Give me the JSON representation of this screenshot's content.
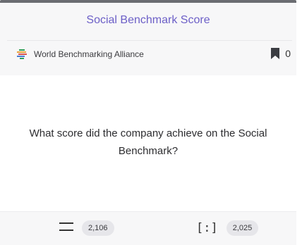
{
  "header": {
    "title": "Social Benchmark Score",
    "source": {
      "name": "World Benchmarking Alliance",
      "logo_icon": "wba-logo-icon"
    },
    "bookmark": {
      "icon": "bookmark-icon",
      "count": "0"
    }
  },
  "card": {
    "question": "What score did the company achieve on the Social Benchmark?"
  },
  "footer": {
    "stat_left": {
      "icon": "equals-lines-icon",
      "value": "2,106"
    },
    "stat_right": {
      "icon": "bracket-colon-icon",
      "value": "2,025"
    }
  },
  "colors": {
    "accent": "#6c5fc7",
    "panel_bg": "#f7f7f8",
    "pill_bg": "#e6e6ea"
  }
}
